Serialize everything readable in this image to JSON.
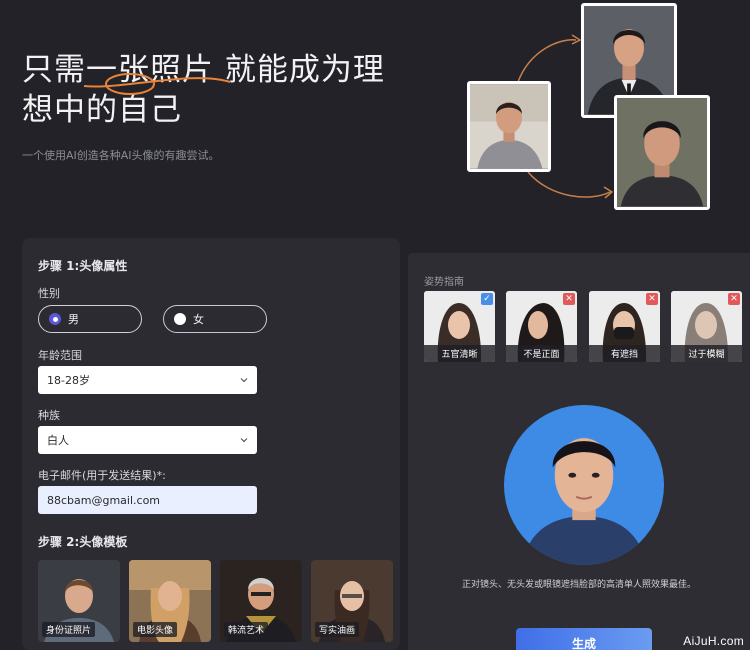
{
  "hero": {
    "title": "只需一张照片 就能成为理想中的自己",
    "subtitle": "一个使用AI创造各种AI头像的有趣尝试。"
  },
  "step1": {
    "title": "步骤 1:头像属性",
    "gender_label": "性别",
    "gender_options": [
      "男",
      "女"
    ],
    "gender_selected": "男",
    "age_label": "年龄范围",
    "age_value": "18-28岁",
    "race_label": "种族",
    "race_value": "白人",
    "email_label": "电子邮件(用于发送结果)*:",
    "email_value": "88cbam@gmail.com"
  },
  "step2": {
    "title": "步骤 2:头像模板",
    "templates": [
      "身份证照片",
      "电影头像",
      "韩流艺术",
      "写实油画"
    ]
  },
  "guide": {
    "title": "姿势指南",
    "poses": [
      {
        "label": "五官清晰",
        "status": "ok"
      },
      {
        "label": "不是正面",
        "status": "bad"
      },
      {
        "label": "有遮挡",
        "status": "bad"
      },
      {
        "label": "过于模糊",
        "status": "bad"
      }
    ],
    "tip": "正对镜头、无头发或眼镜遮挡脸部的高清单人照效果最佳。",
    "generate_label": "生成"
  },
  "colors": {
    "accent": "#5a58d6",
    "ok": "#4a8fe7",
    "bad": "#e05a5a",
    "button": "#3f6ee8",
    "highlight": "#e8833a"
  },
  "watermark": "AiJuH.com"
}
